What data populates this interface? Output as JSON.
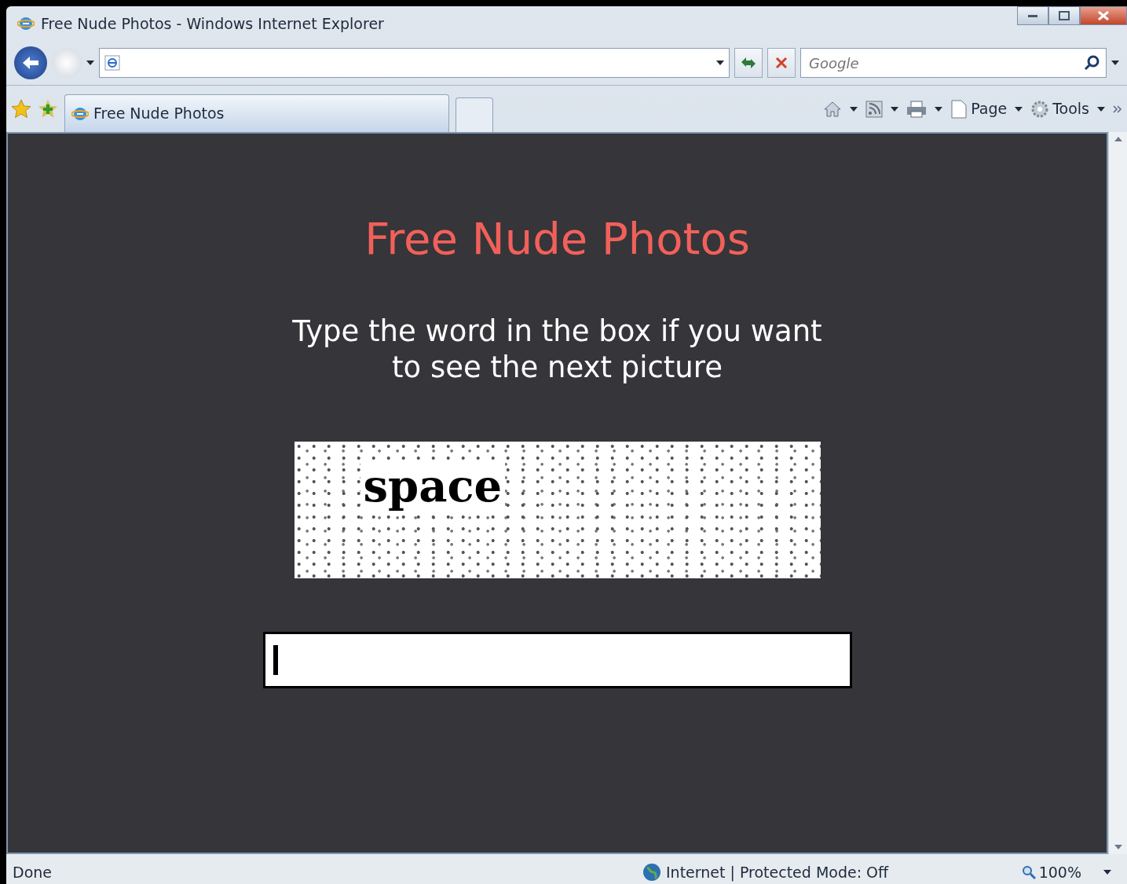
{
  "window": {
    "title": "Free Nude Photos - Windows Internet Explorer"
  },
  "search": {
    "placeholder": "Google"
  },
  "tabs": [
    {
      "label": "Free Nude Photos",
      "selected": true
    }
  ],
  "toolbar": [
    {
      "kind": "home"
    },
    {
      "kind": "feeds"
    },
    {
      "kind": "print"
    },
    {
      "kind": "page",
      "label": "Page"
    },
    {
      "kind": "tools",
      "label": "Tools"
    }
  ],
  "page": {
    "heading": "Free Nude Photos",
    "instruction_lines": [
      "Type the word in the box if you want",
      "to see the next picture"
    ],
    "captcha_word": "space"
  },
  "status_bar": {
    "status": "Done",
    "zone": "Internet | Protected Mode: Off",
    "zoom": "100%"
  }
}
